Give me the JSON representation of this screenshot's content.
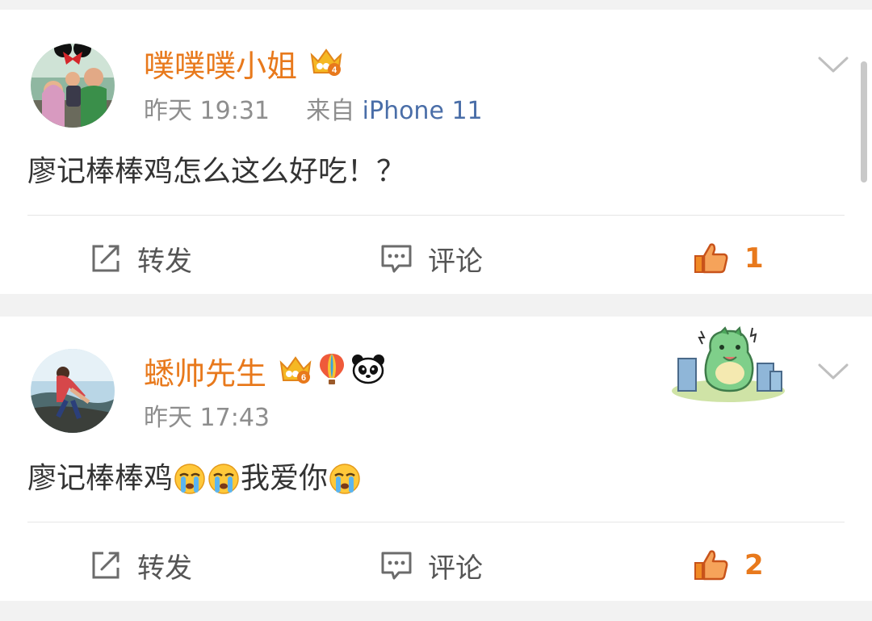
{
  "posts": [
    {
      "username": "噗噗噗小姐",
      "time": "昨天 19:31",
      "source_prefix": "来自",
      "source_device": "iPhone 11",
      "content_text": "廖记棒棒鸡怎么这么好吃！？",
      "badges": [
        "crown-level-4-icon"
      ],
      "actions": {
        "repost": "转发",
        "comment": "评论",
        "like_count": "1"
      }
    },
    {
      "username": "蟋帅先生",
      "time": "昨天 17:43",
      "content_part1": "廖记棒棒鸡",
      "content_part2": "我爱你",
      "badges": [
        "crown-level-6-icon",
        "hot-air-balloon-icon",
        "panda-icon"
      ],
      "sticker": "green-dinosaur-sticker",
      "actions": {
        "repost": "转发",
        "comment": "评论",
        "like_count": "2"
      }
    }
  ],
  "colors": {
    "accent": "#e8791c",
    "link": "#4a6ea8",
    "text": "#333333",
    "meta": "#8e8e8e"
  }
}
